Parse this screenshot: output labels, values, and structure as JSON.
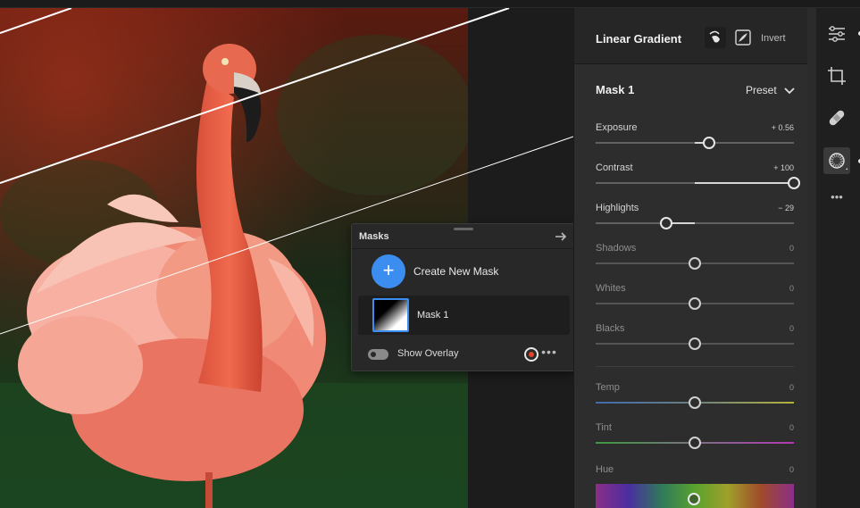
{
  "masks_panel": {
    "title": "Masks",
    "create_label": "Create New Mask",
    "create_icon": "+",
    "mask_item_label": "Mask 1",
    "overlay_label": "Show Overlay",
    "overlay_color": "#e0452a",
    "more_icon": "•••"
  },
  "edit_panel": {
    "title": "Linear Gradient",
    "invert_label": "Invert",
    "mask_name": "Mask 1",
    "preset_label": "Preset",
    "sliders": [
      {
        "label": "Exposure",
        "value_text": "+ 0.56",
        "value": 0.56,
        "min": -4,
        "max": 4
      },
      {
        "label": "Contrast",
        "value_text": "+ 100",
        "value": 100,
        "min": -100,
        "max": 100
      },
      {
        "label": "Highlights",
        "value_text": "− 29",
        "value": -29,
        "min": -100,
        "max": 100
      },
      {
        "label": "Shadows",
        "value_text": "0",
        "value": 0,
        "min": -100,
        "max": 100
      },
      {
        "label": "Whites",
        "value_text": "0",
        "value": 0,
        "min": -100,
        "max": 100
      },
      {
        "label": "Blacks",
        "value_text": "0",
        "value": 0,
        "min": -100,
        "max": 100
      }
    ],
    "color_sliders": [
      {
        "label": "Temp",
        "value_text": "0",
        "value": 0,
        "min": -100,
        "max": 100
      },
      {
        "label": "Tint",
        "value_text": "0",
        "value": 0,
        "min": -100,
        "max": 100
      }
    ],
    "hue": {
      "label": "Hue",
      "value_text": "0",
      "value": 0
    }
  },
  "toolbar": {
    "tools": [
      "sliders-icon",
      "crop-icon",
      "bandage-icon",
      "mask-icon",
      "more-icon"
    ],
    "more_label": "•••",
    "active_tool": "mask-icon"
  }
}
